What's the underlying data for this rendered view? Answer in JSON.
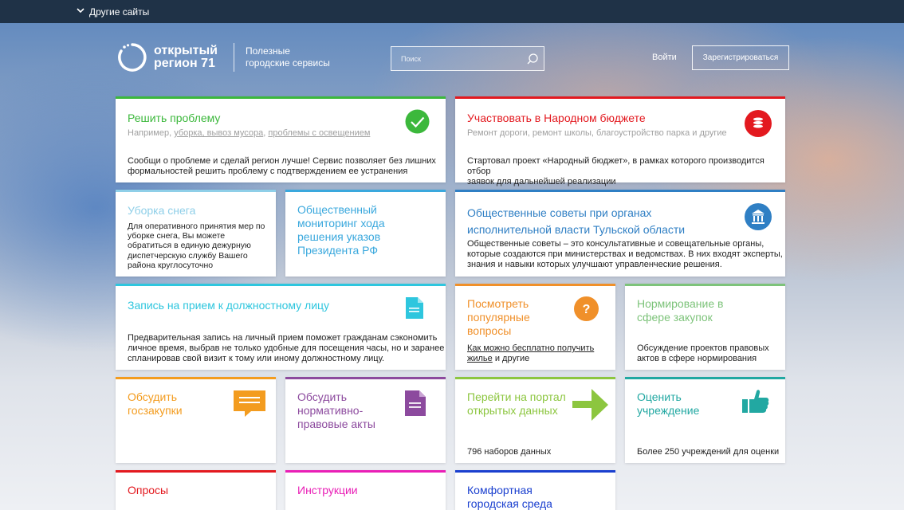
{
  "topbar": {
    "other_sites": "Другие сайты"
  },
  "logo": {
    "line1": "открытый",
    "line2": "регион 71",
    "subtitle_line1": "Полезные",
    "subtitle_line2": "городские сервисы"
  },
  "search": {
    "placeholder": "Поиск"
  },
  "auth": {
    "login": "Войти",
    "register": "Зарегистрироваться"
  },
  "cards": {
    "problem": {
      "title": "Решить проблему",
      "hint_prefix": "Например, ",
      "hint_link1": "уборка, вывоз мусора",
      "hint_sep": ", ",
      "hint_link2": "проблемы с освещением",
      "desc_line1": "Сообщи о проблеме и сделай регион лучше! Сервис позволяет без лишних",
      "desc_line2": "формальностей решить проблему с подтверждением ее устранения",
      "color": "#3cb83c",
      "icon": "checkmark-icon"
    },
    "budget": {
      "title": "Участвовать в Народном бюджете",
      "subtitle": "Ремонт дороги, ремонт школы, благоустройство парка и другие",
      "desc_line1": "Стартовал проект «Народный бюджет», в рамках которого производится отбор",
      "desc_line2": "заявок для дальнейшей реализации",
      "color": "#e3191f",
      "icon": "coins-icon"
    },
    "snow": {
      "title": "Уборка снега",
      "desc_lines": [
        "Для оперативного принятия мер по",
        "уборке снега,  Вы можете",
        "обратиться в единую дежурную",
        "диспетчерскую службу Вашего",
        "района круглосуточно"
      ],
      "color": "#8fcfe8"
    },
    "monitoring": {
      "title_lines": [
        "Общественный",
        "мониторинг хода",
        "решения указов",
        "Президента РФ"
      ],
      "color": "#3aa8dd"
    },
    "councils": {
      "title_line1": "Общественные советы при органах",
      "title_line2": "исполнительной власти Тульской области",
      "desc_line1": "Общественные советы – это консультативные и совещательные органы,",
      "desc_line2": "которые создаются при министерствах и ведомствах. В них входят эксперты,",
      "desc_line3": "знания и навыки которых улучшают управленческие решения.",
      "color": "#2f7fc4",
      "icon": "government-building-icon"
    },
    "appointment": {
      "title": "Запись на прием к должностному лицу",
      "desc_line1": "Предварительная запись на личный прием поможет гражданам сэкономить",
      "desc_line2": "личное время, выбрав не только удобные для посещения часы, но и заранее",
      "desc_line3": "спланировав свой визит к тому или иному должностному лицу.",
      "color": "#2ec6de",
      "icon": "document-icon"
    },
    "faq": {
      "title_lines": [
        "Посмотреть",
        "популярные",
        "вопросы"
      ],
      "link_line1": "Как можно бесплатно получить",
      "link_line2": "жилье",
      "suffix": " и другие",
      "color": "#f0902a",
      "icon": "question-icon"
    },
    "procurement_norms": {
      "title_lines": [
        "Нормирование в",
        "сфере закупок"
      ],
      "desc_line1": "Обсуждение проектов правовых",
      "desc_line2": "актов в сфере нормирования",
      "color": "#7dc37a"
    },
    "discuss_procurement": {
      "title_lines": [
        "Обсудить",
        "госзакупки"
      ],
      "color": "#f39c1f",
      "icon": "chat-bubble-icon"
    },
    "discuss_acts": {
      "title_lines": [
        "Обсудить",
        "нормативно-",
        "правовые акты"
      ],
      "color": "#8c4a9e",
      "icon": "document-icon"
    },
    "open_data": {
      "title_lines": [
        "Перейти на портал",
        "открытых данных"
      ],
      "footer": "796 наборов данных",
      "color": "#8cc63f",
      "icon": "arrow-right-icon"
    },
    "rate": {
      "title_lines": [
        "Оценить",
        "учреждение"
      ],
      "footer": "Более 250 учреждений для оценки",
      "color": "#22a8a2",
      "icon": "thumbs-up-icon"
    },
    "polls": {
      "title": "Опросы",
      "color": "#e3191f"
    },
    "instructions": {
      "title": "Инструкции",
      "color": "#e91eb6"
    },
    "comfortable": {
      "title_lines": [
        "Комфортная",
        "городская среда"
      ],
      "color": "#1a3fcf"
    }
  }
}
